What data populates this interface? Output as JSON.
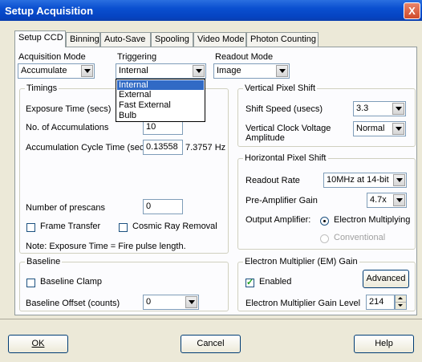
{
  "window": {
    "title": "Setup Acquisition",
    "close": "X"
  },
  "tabs": [
    "Setup CCD",
    "Binning",
    "Auto-Save",
    "Spooling",
    "Video Mode",
    "Photon Counting"
  ],
  "acquisition_mode": {
    "label": "Acquisition Mode",
    "value": "Accumulate"
  },
  "triggering": {
    "label": "Triggering",
    "value": "Internal",
    "options": [
      "Internal",
      "External",
      "Fast External",
      "Bulb"
    ],
    "highlighted": "Internal"
  },
  "readout_mode": {
    "label": "Readout Mode",
    "value": "Image"
  },
  "timings": {
    "title": "Timings",
    "exposure_label": "Exposure Time (secs)",
    "accumulations_label": "No. of Accumulations",
    "accumulations_value": "10",
    "cycle_label": "Accumulation Cycle Time (secs)",
    "cycle_value": "0.13558",
    "cycle_hz": "7.3757 Hz",
    "prescans_label": "Number of prescans",
    "prescans_value": "0",
    "frame_transfer": "Frame Transfer",
    "cosmic_ray": "Cosmic Ray Removal",
    "note": "Note: Exposure Time = Fire pulse length."
  },
  "baseline": {
    "title": "Baseline",
    "clamp_label": "Baseline Clamp",
    "offset_label": "Baseline Offset (counts)",
    "offset_value": "0"
  },
  "vertical_shift": {
    "title": "Vertical Pixel Shift",
    "speed_label": "Shift Speed (usecs)",
    "speed_value": "3.3",
    "clock_label_1": "Vertical Clock Voltage",
    "clock_label_2": "Amplitude",
    "clock_value": "Normal"
  },
  "horizontal_shift": {
    "title": "Horizontal Pixel Shift",
    "readout_label": "Readout Rate",
    "readout_value": "10MHz at 14-bit",
    "preamp_label": "Pre-Amplifier Gain",
    "preamp_value": "4.7x",
    "output_label": "Output Amplifier:",
    "em_option": "Electron Multiplying",
    "conv_option": "Conventional"
  },
  "em_gain": {
    "title": "Electron Multiplier (EM) Gain",
    "enabled_label": "Enabled",
    "advanced_label": "Advanced",
    "level_label": "Electron Multiplier Gain Level",
    "level_value": "214"
  },
  "footer": {
    "ok": "OK",
    "cancel": "Cancel",
    "help": "Help"
  }
}
